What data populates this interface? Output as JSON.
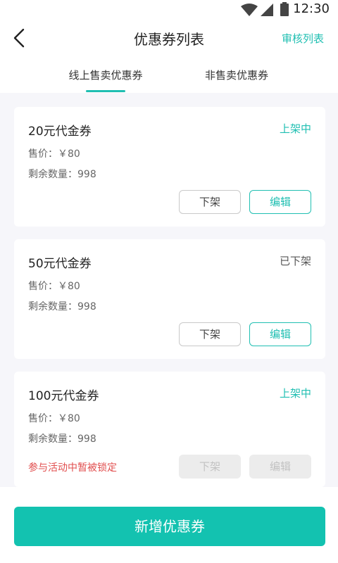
{
  "status_bar": {
    "time": "12:30",
    "icons": [
      "wifi-icon",
      "signal-icon",
      "battery-icon"
    ]
  },
  "nav": {
    "back_icon": "chevron-left-icon",
    "title": "优惠券列表",
    "right_link": "审核列表"
  },
  "tabs": [
    {
      "label": "线上售卖优惠券",
      "active": true
    },
    {
      "label": "非售卖优惠券",
      "active": false
    }
  ],
  "coupons": [
    {
      "title": "20元代金券",
      "status": "上架中",
      "price": "售价：￥80",
      "quantity": "剩余数量：998",
      "note": "",
      "btn_down": "下架",
      "btn_edit": "编辑",
      "disabled": false
    },
    {
      "title": "50元代金券",
      "status": "已下架",
      "price": "售价：￥80",
      "quantity": "剩余数量：998",
      "note": "",
      "btn_down": "下架",
      "btn_edit": "编辑",
      "disabled": false
    },
    {
      "title": "100元代金券",
      "status": "上架中",
      "price": "售价：￥80",
      "quantity": "剩余数量：998",
      "note": "参与活动中暂被锁定",
      "btn_down": "下架",
      "btn_edit": "编辑",
      "disabled": true
    }
  ],
  "footer": {
    "add_button": "新增优惠券"
  },
  "colors": {
    "accent": "#20bfb2",
    "button": "#13c2b0",
    "warning": "#e14e4e"
  }
}
